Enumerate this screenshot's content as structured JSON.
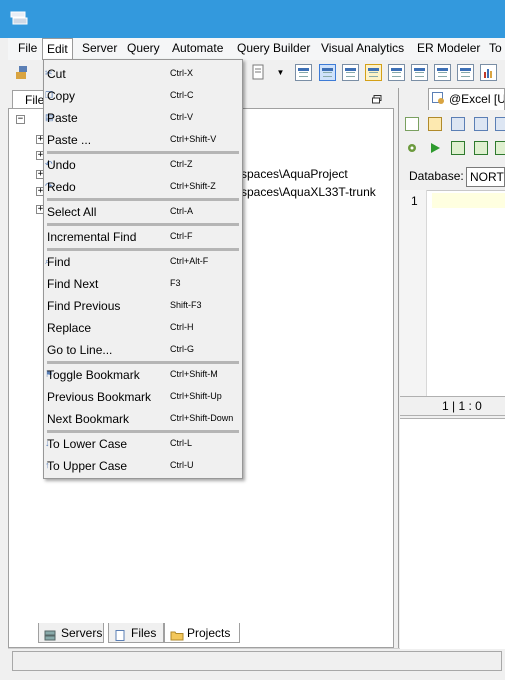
{
  "menubar": {
    "items": [
      "File",
      "Edit",
      "Server",
      "Query",
      "Automate",
      "Query Builder",
      "Visual Analytics",
      "ER Modeler",
      "To"
    ]
  },
  "left_panel": {
    "tab_label": "File",
    "tree_items": [
      {
        "text": ""
      },
      {
        "text": ""
      },
      {
        "text": ""
      },
      {
        "text": "spaces\\AquaProject"
      },
      {
        "text": "spaces\\AquaXL33T-trunk"
      },
      {
        "text": ""
      }
    ]
  },
  "bottom_tabs": [
    "Servers",
    "Files",
    "Projects"
  ],
  "editor": {
    "tab_label": "@Excel [Ur",
    "database_label": "Database:",
    "database_value": "NORTH",
    "line_number": "1",
    "position": "1 | 1 : 0"
  },
  "edit_menu": {
    "items": [
      {
        "label": "Cut",
        "shortcut": "Ctrl-X"
      },
      {
        "label": "Copy",
        "shortcut": "Ctrl-C"
      },
      {
        "label": "Paste",
        "shortcut": "Ctrl-V"
      },
      {
        "label": "Paste ...",
        "shortcut": "Ctrl+Shift-V"
      },
      {
        "label": "Undo",
        "shortcut": "Ctrl-Z"
      },
      {
        "label": "Redo",
        "shortcut": "Ctrl+Shift-Z"
      },
      {
        "label": "Select All",
        "shortcut": "Ctrl-A"
      },
      {
        "label": "Incremental Find",
        "shortcut": "Ctrl-F"
      },
      {
        "label": "Find",
        "shortcut": "Ctrl+Alt-F"
      },
      {
        "label": "Find Next",
        "shortcut": "F3"
      },
      {
        "label": "Find Previous",
        "shortcut": "Shift-F3"
      },
      {
        "label": "Replace",
        "shortcut": "Ctrl-H"
      },
      {
        "label": "Go to Line...",
        "shortcut": "Ctrl-G"
      },
      {
        "label": "Toggle Bookmark",
        "shortcut": "Ctrl+Shift-M"
      },
      {
        "label": "Previous Bookmark",
        "shortcut": "Ctrl+Shift-Up"
      },
      {
        "label": "Next Bookmark",
        "shortcut": "Ctrl+Shift-Down"
      },
      {
        "label": "To Lower Case",
        "shortcut": "Ctrl-L"
      },
      {
        "label": "To Upper Case",
        "shortcut": "Ctrl-U"
      }
    ]
  },
  "colors": {
    "titlebar": "#3399dd",
    "menu_bg": "#f0f0f0",
    "separator": "#b5b5b5"
  }
}
